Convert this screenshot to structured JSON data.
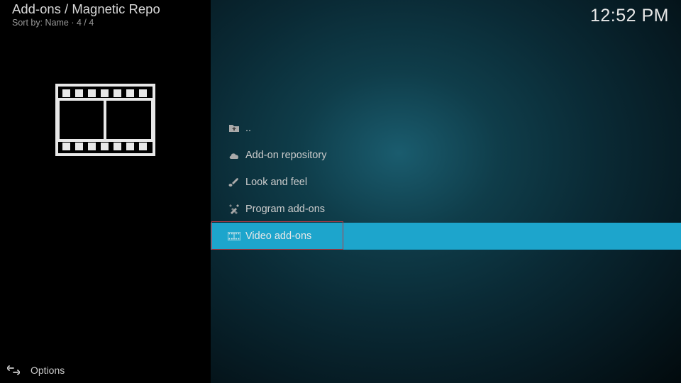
{
  "header": {
    "title": "Add-ons / Magnetic Repo",
    "subtitle": "Sort by: Name  ·  4 / 4"
  },
  "clock": "12:52 PM",
  "list": {
    "items": [
      {
        "icon": "folder-up",
        "label": ".."
      },
      {
        "icon": "cloud",
        "label": "Add-on repository"
      },
      {
        "icon": "paint",
        "label": "Look and feel"
      },
      {
        "icon": "tools",
        "label": "Program add-ons"
      },
      {
        "icon": "film",
        "label": "Video add-ons",
        "selected": true,
        "highlighted": true
      }
    ]
  },
  "footer": {
    "label": "Options"
  }
}
